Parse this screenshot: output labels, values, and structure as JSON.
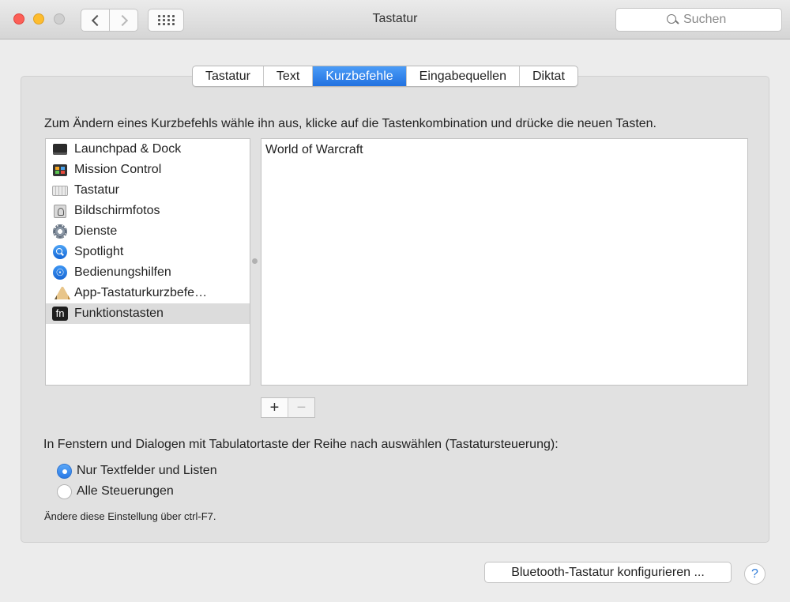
{
  "window": {
    "title": "Tastatur"
  },
  "search": {
    "placeholder": "Suchen"
  },
  "tabs": [
    {
      "label": "Tastatur",
      "active": false
    },
    {
      "label": "Text",
      "active": false
    },
    {
      "label": "Kurzbefehle",
      "active": true
    },
    {
      "label": "Eingabequellen",
      "active": false
    },
    {
      "label": "Diktat",
      "active": false
    }
  ],
  "instructions": "Zum Ändern eines Kurzbefehls wähle ihn aus, klicke auf die Tastenkombination und drücke die neuen Tasten.",
  "categories": [
    {
      "label": "Launchpad & Dock",
      "icon": "launchpad-icon"
    },
    {
      "label": "Mission Control",
      "icon": "mission-control-icon"
    },
    {
      "label": "Tastatur",
      "icon": "keyboard-icon"
    },
    {
      "label": "Bildschirmfotos",
      "icon": "screenshot-icon"
    },
    {
      "label": "Dienste",
      "icon": "gear-icon"
    },
    {
      "label": "Spotlight",
      "icon": "spotlight-icon"
    },
    {
      "label": "Bedienungshilfen",
      "icon": "accessibility-icon"
    },
    {
      "label": "App-Tastaturkurzbefe…",
      "icon": "app-store-icon"
    },
    {
      "label": "Funktionstasten",
      "icon": "fn-key-icon",
      "selected": true
    }
  ],
  "shortcuts": [
    "World of Warcraft"
  ],
  "buttons": {
    "add": "+",
    "remove": "−"
  },
  "tab_navigation": {
    "label": "In Fenstern und Dialogen mit Tabulatortaste der Reihe nach auswählen (Tastatursteuerung):",
    "options": [
      {
        "label": "Nur Textfelder und Listen",
        "selected": true
      },
      {
        "label": "Alle Steuerungen",
        "selected": false
      }
    ],
    "hint": "Ändere diese Einstellung über ctrl-F7."
  },
  "footer": {
    "bluetooth_button": "Bluetooth-Tastatur konfigurieren ...",
    "help": "?"
  },
  "icon_text": {
    "fn": "fn",
    "accessibility": "☉"
  },
  "colors": {
    "accent": "#2f7de8",
    "selection": "#dcdcdc"
  }
}
